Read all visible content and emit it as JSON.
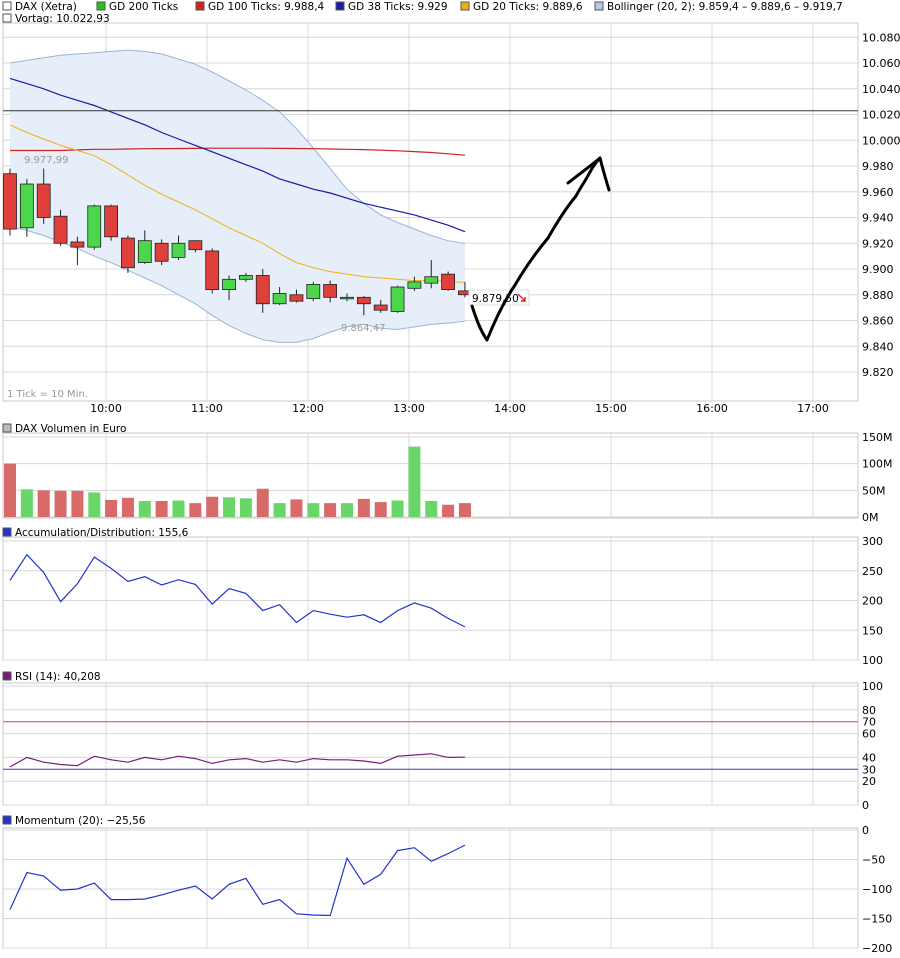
{
  "colors": {
    "up": "#4cd64c",
    "down": "#e0403c",
    "gd200": "#2ec42e",
    "gd100": "#cc2222",
    "gd38": "#1a1aa8",
    "gd20": "#f0b010",
    "bollinger": "#9ab4d8",
    "band_fill": "#e6eefa",
    "grid": "#d8d8d8",
    "vol_up": "#6ad66a",
    "vol_down": "#d96a6a",
    "ad_line": "#2233cc",
    "rsi_line": "#7a1a7a",
    "mom_line": "#2233cc",
    "hline": "#222222"
  },
  "price_panel": {
    "legend": [
      {
        "label": "DAX (Xetra)",
        "swatch": "#ffffff"
      },
      {
        "label": "GD 200 Ticks",
        "swatch": "#22c322"
      },
      {
        "label": "GD 100 Ticks: 9.988,4",
        "swatch": "#d42020"
      },
      {
        "label": "GD 38 Ticks: 9.929",
        "swatch": "#1a1aa8"
      },
      {
        "label": "GD 20 Ticks: 9.889,6",
        "swatch": "#f0b010"
      },
      {
        "label": "Bollinger (20, 2): 9.859,4 – 9.889,6 – 9.919,7",
        "swatch": "#b4c8e8"
      }
    ],
    "prev_close_label": "Vortag: 10.022,93",
    "prev_close": 10022.93,
    "high_label": "9.977,99",
    "low_label": "9.864,47",
    "last_label": "9.879,50",
    "tick_note": "1 Tick = 10 Min."
  },
  "volume_panel": {
    "title": "DAX Volumen in Euro"
  },
  "ad_panel": {
    "title": "Accumulation/Distribution: 155,6"
  },
  "rsi_panel": {
    "title": "RSI (14): 40,208"
  },
  "momentum_panel": {
    "title": "Momentum (20): −25,56"
  },
  "chart_data": [
    {
      "type": "candlestick",
      "title": "DAX (Xetra)",
      "x_ticks": [
        "10:00",
        "11:00",
        "12:00",
        "13:00",
        "14:00",
        "15:00",
        "16:00",
        "17:00"
      ],
      "y_ticks": [
        "10.080",
        "10.060",
        "10.040",
        "10.020",
        "10.000",
        "9.980",
        "9.960",
        "9.940",
        "9.920",
        "9.900",
        "9.880",
        "9.860",
        "9.840",
        "9.820"
      ],
      "ylim": [
        9800,
        10090
      ],
      "times": [
        "09:00",
        "09:10",
        "09:20",
        "09:30",
        "09:40",
        "09:50",
        "10:00",
        "10:10",
        "10:20",
        "10:30",
        "10:40",
        "10:50",
        "11:00",
        "11:10",
        "11:20",
        "11:30",
        "11:40",
        "11:50",
        "12:00",
        "12:10",
        "12:20",
        "12:30",
        "12:40",
        "12:50",
        "13:00",
        "13:10",
        "13:20",
        "13:30"
      ],
      "candles": [
        {
          "o": 9974,
          "h": 9978,
          "l": 9926,
          "c": 9931
        },
        {
          "o": 9932,
          "h": 9970,
          "l": 9925,
          "c": 9966
        },
        {
          "o": 9966,
          "h": 9978,
          "l": 9935,
          "c": 9940
        },
        {
          "o": 9941,
          "h": 9946,
          "l": 9918,
          "c": 9920
        },
        {
          "o": 9921,
          "h": 9925,
          "l": 9903,
          "c": 9917
        },
        {
          "o": 9917,
          "h": 9950,
          "l": 9915,
          "c": 9949
        },
        {
          "o": 9949,
          "h": 9950,
          "l": 9922,
          "c": 9925
        },
        {
          "o": 9924,
          "h": 9926,
          "l": 9897,
          "c": 9901
        },
        {
          "o": 9905,
          "h": 9930,
          "l": 9904,
          "c": 9922
        },
        {
          "o": 9920,
          "h": 9923,
          "l": 9903,
          "c": 9906
        },
        {
          "o": 9909,
          "h": 9926,
          "l": 9907,
          "c": 9920
        },
        {
          "o": 9922,
          "h": 9922,
          "l": 9913,
          "c": 9915
        },
        {
          "o": 9914,
          "h": 9916,
          "l": 9881,
          "c": 9884
        },
        {
          "o": 9884,
          "h": 9895,
          "l": 9876,
          "c": 9892
        },
        {
          "o": 9892,
          "h": 9897,
          "l": 9890,
          "c": 9895
        },
        {
          "o": 9895,
          "h": 9900,
          "l": 9866,
          "c": 9873
        },
        {
          "o": 9873,
          "h": 9886,
          "l": 9872,
          "c": 9881
        },
        {
          "o": 9880,
          "h": 9884,
          "l": 9874,
          "c": 9875
        },
        {
          "o": 9877,
          "h": 9890,
          "l": 9875,
          "c": 9888
        },
        {
          "o": 9888,
          "h": 9891,
          "l": 9874,
          "c": 9878
        },
        {
          "o": 9878,
          "h": 9881,
          "l": 9875,
          "c": 9878
        },
        {
          "o": 9878,
          "h": 9879,
          "l": 9864,
          "c": 9873
        },
        {
          "o": 9872,
          "h": 9876,
          "l": 9866,
          "c": 9868
        },
        {
          "o": 9867,
          "h": 9887,
          "l": 9866,
          "c": 9886
        },
        {
          "o": 9885,
          "h": 9894,
          "l": 9883,
          "c": 9890
        },
        {
          "o": 9889,
          "h": 9907,
          "l": 9885,
          "c": 9894
        },
        {
          "o": 9896,
          "h": 9898,
          "l": 9883,
          "c": 9884
        },
        {
          "o": 9883,
          "h": 9890,
          "l": 9878,
          "c": 9880
        }
      ],
      "series": [
        {
          "name": "GD 100 Ticks",
          "values": [
            9992,
            9992,
            9992,
            9992,
            9992.5,
            9993,
            9993,
            9993.2,
            9993.4,
            9993.5,
            9993.6,
            9993.7,
            9993.8,
            9993.8,
            9993.8,
            9993.8,
            9993.7,
            9993.6,
            9993.4,
            9993.2,
            9993,
            9992.7,
            9992.3,
            9991.8,
            9991.2,
            9990.5,
            9989.5,
            9988.4
          ]
        },
        {
          "name": "GD 38 Ticks",
          "values": [
            10048,
            10044,
            10040,
            10035,
            10031,
            10027,
            10022,
            10017,
            10012,
            10006,
            10001,
            9996,
            9991,
            9986,
            9981,
            9976,
            9970,
            9966,
            9962,
            9959,
            9955,
            9951,
            9948,
            9945,
            9942,
            9938,
            9934,
            9929
          ]
        },
        {
          "name": "GD 20 Ticks",
          "values": [
            10012,
            10006,
            10001,
            9996,
            9992,
            9988,
            9981,
            9973,
            9965,
            9958,
            9952,
            9946,
            9939,
            9932,
            9926,
            9920,
            9912,
            9905,
            9901,
            9898,
            9896,
            9894,
            9893,
            9892,
            9891,
            9891,
            9890.3,
            9889.6
          ]
        },
        {
          "name": "Bollinger upper",
          "values": [
            10060,
            10062,
            10064,
            10066,
            10067,
            10068,
            10069,
            10070,
            10069,
            10067,
            10063,
            10059,
            10053,
            10046,
            10039,
            10031,
            10022,
            10009,
            9994,
            9978,
            9962,
            9951,
            9942,
            9936,
            9931,
            9926,
            9922,
            9919.7
          ]
        },
        {
          "name": "Bollinger lower",
          "values": [
            9933,
            9930,
            9926,
            9921,
            9916,
            9910,
            9905,
            9899,
            9893,
            9887,
            9880,
            9873,
            9864,
            9856,
            9850,
            9845,
            9843,
            9843,
            9846,
            9851,
            9855,
            9857,
            9854,
            9853,
            9855,
            9857,
            9858,
            9859.4
          ]
        }
      ]
    },
    {
      "type": "bar",
      "title": "DAX Volumen in Euro",
      "y_ticks": [
        "150M",
        "100M",
        "50M",
        "0M"
      ],
      "ylim": [
        0,
        150
      ],
      "unit": "M",
      "values": [
        100,
        52,
        50,
        49,
        49,
        46,
        32,
        36,
        30,
        30,
        31,
        26,
        38,
        37,
        35,
        53,
        26,
        33,
        26,
        26,
        26,
        34,
        28,
        31,
        132,
        30,
        23,
        26
      ]
    },
    {
      "type": "line",
      "title": "Accumulation/Distribution",
      "y_ticks": [
        "300",
        "250",
        "200",
        "150",
        "100"
      ],
      "ylim": [
        100,
        300
      ],
      "values": [
        234,
        277,
        247,
        198,
        228,
        273,
        254,
        232,
        240,
        226,
        235,
        227,
        194,
        220,
        212,
        183,
        193,
        163,
        183,
        177,
        172,
        176,
        163,
        183,
        196,
        187,
        170,
        155.6
      ]
    },
    {
      "type": "line",
      "title": "RSI (14)",
      "y_ticks": [
        "100",
        "80",
        "70",
        "60",
        "40",
        "30",
        "20",
        "0"
      ],
      "ylim": [
        0,
        100
      ],
      "reference_lines": [
        70,
        30
      ],
      "values": [
        32,
        40,
        36,
        34,
        33,
        41,
        38,
        36,
        40,
        38,
        41,
        39,
        35,
        38,
        39,
        36,
        38,
        36,
        39,
        38,
        38,
        37,
        35,
        41,
        42,
        43,
        40,
        40.2
      ]
    },
    {
      "type": "line",
      "title": "Momentum (20)",
      "y_ticks": [
        "0",
        "−50",
        "−100",
        "−150",
        "−200"
      ],
      "ylim": [
        -200,
        0
      ],
      "values": [
        -135,
        -72,
        -78,
        -102,
        -100,
        -90,
        -118,
        -118,
        -117,
        -110,
        -102,
        -95,
        -117,
        -92,
        -82,
        -126,
        -118,
        -142,
        -144,
        -145,
        -48,
        -92,
        -75,
        -35,
        -30,
        -53,
        -40,
        -25.56
      ]
    }
  ]
}
